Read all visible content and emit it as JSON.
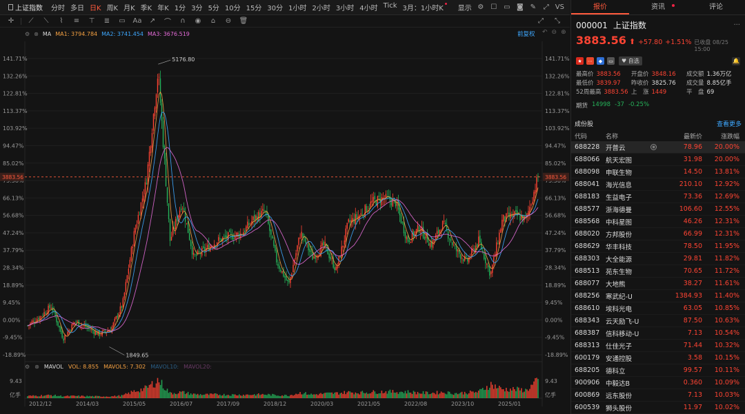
{
  "toolbar": {
    "symbol": "上证指数",
    "periods": [
      "分时",
      "多日",
      "日K",
      "周K",
      "月K",
      "季K",
      "年K",
      "1分",
      "3分",
      "5分",
      "10分",
      "15分",
      "30分",
      "1小时",
      "2小时",
      "3小时",
      "4小时",
      "Tick",
      "3月：1小时K"
    ],
    "active_period": "日K",
    "display_label": "显示",
    "vs_label": "VS"
  },
  "ma_legend": {
    "label": "MA",
    "ma1": "MA1: 3794.784",
    "ma2": "MA2: 3741.454",
    "ma3": "MA3: 3676.519",
    "adjust": "前复权"
  },
  "vol_legend": {
    "label": "MAVOL",
    "vol": "VOL: 8.855",
    "mavol5": "MAVOL5: 7.302",
    "mavol10": "MAVOL10:",
    "mavol20": "MAVOL20:"
  },
  "chart_data": {
    "type": "line",
    "title": "",
    "price_axis_ticks": [
      "141.71%",
      "132.26%",
      "122.81%",
      "113.37%",
      "103.92%",
      "94.47%",
      "85.02%",
      "75.58%",
      "66.13%",
      "56.68%",
      "47.24%",
      "37.79%",
      "28.34%",
      "18.89%",
      "9.45%",
      "0.00%",
      "-9.45%",
      "-18.89%"
    ],
    "time_axis_ticks": [
      "2012/12",
      "2014/03",
      "2015/05",
      "2016/07",
      "2017/09",
      "2018/12",
      "2020/03",
      "2021/05",
      "2022/08",
      "2023/10",
      "2025/01"
    ],
    "current_price_label": "3883.56",
    "high_annotation": "5176.80",
    "low_annotation": "1849.65",
    "volume_axis": {
      "max": "9.43",
      "unit": "亿手"
    },
    "x": [
      "2012/09",
      "2012/12",
      "2013/03",
      "2013/06",
      "2013/09",
      "2013/12",
      "2014/03",
      "2014/06",
      "2014/09",
      "2014/12",
      "2015/03",
      "2015/06",
      "2015/09",
      "2015/12",
      "2016/03",
      "2016/07",
      "2016/10",
      "2017/01",
      "2017/04",
      "2017/09",
      "2018/01",
      "2018/06",
      "2018/12",
      "2019/04",
      "2019/08",
      "2020/01",
      "2020/03",
      "2020/07",
      "2020/12",
      "2021/05",
      "2021/09",
      "2022/01",
      "2022/04",
      "2022/08",
      "2022/12",
      "2023/05",
      "2023/10",
      "2024/02",
      "2024/05",
      "2024/09",
      "2024/12",
      "2025/03",
      "2025/05",
      "2025/08"
    ],
    "series": [
      {
        "values": [
          2100,
          2200,
          2330,
          1950,
          2150,
          2080,
          2000,
          2050,
          2350,
          3200,
          3800,
          5100,
          3100,
          3550,
          2900,
          3000,
          3100,
          3150,
          3180,
          3350,
          3450,
          2850,
          2580,
          3200,
          2900,
          3050,
          2750,
          3300,
          3400,
          3550,
          3600,
          3550,
          3100,
          3250,
          3050,
          3300,
          3000,
          2850,
          3100,
          2700,
          3350,
          3400,
          3350,
          3850
        ]
      }
    ],
    "volume": [
      1.1,
      1.3,
      1.5,
      1.0,
      1.1,
      1.0,
      0.9,
      0.9,
      1.3,
      3.5,
      5.0,
      9.2,
      2.5,
      3.0,
      2.0,
      1.8,
      1.9,
      1.7,
      1.7,
      1.8,
      1.9,
      1.5,
      1.4,
      2.8,
      1.8,
      2.3,
      2.5,
      3.0,
      2.8,
      3.1,
      3.3,
      3.2,
      3.2,
      2.7,
      2.6,
      3.0,
      2.4,
      2.8,
      3.2,
      7.0,
      4.5,
      4.5,
      4.0,
      8.8
    ],
    "ylim": [
      1700,
      5300
    ]
  },
  "panel": {
    "tabs": [
      "报价",
      "资讯",
      "评论"
    ],
    "code": "000001",
    "name": "上证指数",
    "price": "3883.56",
    "change": "+57.80",
    "change_pct": "+1.51%",
    "close_time": "已收盘 08/25 15:00",
    "watch": "自选",
    "stats": [
      [
        {
          "k": "最高价",
          "v": "3883.56",
          "c": "up"
        },
        {
          "k": "开盘价",
          "v": "3848.16",
          "c": "up"
        },
        {
          "k": "成交额",
          "v": "1.36万亿",
          "c": "wh"
        }
      ],
      [
        {
          "k": "最低价",
          "v": "3839.97",
          "c": "up"
        },
        {
          "k": "昨收价",
          "v": "3825.76",
          "c": "wh"
        },
        {
          "k": "成交量",
          "v": "8.85亿手",
          "c": "wh"
        }
      ],
      [
        {
          "k": "52周最高",
          "v": "3883.56",
          "c": "up"
        },
        {
          "k": "上　涨",
          "v": "1449",
          "c": "up"
        },
        {
          "k": "平　盘",
          "v": "69",
          "c": "wh"
        }
      ]
    ],
    "futures": {
      "label": "期货",
      "price": "14998",
      "change": "-37",
      "pct": "-0.25%"
    },
    "constituents_title": "成份股",
    "view_more": "查看更多",
    "columns": [
      "代码",
      "名称",
      "最新价",
      "涨跌幅"
    ],
    "rows": [
      [
        "688228",
        "开普云",
        "78.96",
        "20.00%"
      ],
      [
        "688066",
        "航天宏图",
        "31.98",
        "20.00%"
      ],
      [
        "688098",
        "申联生物",
        "14.50",
        "13.81%"
      ],
      [
        "688041",
        "海光信息",
        "210.10",
        "12.92%"
      ],
      [
        "688183",
        "生益电子",
        "73.36",
        "12.69%"
      ],
      [
        "688577",
        "浙海德曼",
        "106.60",
        "12.55%"
      ],
      [
        "688568",
        "中科星图",
        "46.26",
        "12.31%"
      ],
      [
        "688020",
        "方邦股份",
        "66.99",
        "12.31%"
      ],
      [
        "688629",
        "华丰科技",
        "78.50",
        "11.95%"
      ],
      [
        "688303",
        "大全能源",
        "29.81",
        "11.82%"
      ],
      [
        "688513",
        "苑东生物",
        "70.65",
        "11.72%"
      ],
      [
        "688077",
        "大地熊",
        "38.27",
        "11.61%"
      ],
      [
        "688256",
        "寒武纪-U",
        "1384.93",
        "11.40%"
      ],
      [
        "688610",
        "埃科光电",
        "63.05",
        "10.85%"
      ],
      [
        "688343",
        "云天励飞-U",
        "87.50",
        "10.63%"
      ],
      [
        "688387",
        "信科移动-U",
        "7.13",
        "10.54%"
      ],
      [
        "688313",
        "仕佳光子",
        "71.44",
        "10.32%"
      ],
      [
        "600179",
        "安通控股",
        "3.58",
        "10.15%"
      ],
      [
        "688205",
        "德科立",
        "99.57",
        "10.11%"
      ],
      [
        "900906",
        "中毅达B",
        "0.360",
        "10.09%"
      ],
      [
        "600869",
        "远东股份",
        "7.13",
        "10.03%"
      ],
      [
        "600539",
        "狮头股份",
        "11.97",
        "10.02%"
      ]
    ]
  }
}
